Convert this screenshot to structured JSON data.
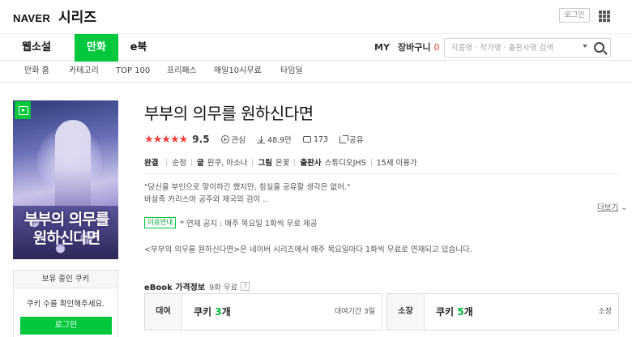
{
  "header": {
    "brand": "NAVER",
    "service": "시리즈",
    "login": "로그인"
  },
  "nav": {
    "tabs": [
      "웹소설",
      "만화",
      "e북"
    ],
    "active_tab": "만화",
    "my": "MY",
    "cart_label": "장바구니",
    "cart_count": "0",
    "search_placeholder": "작품명 · 작가명 · 출판사명 검색"
  },
  "subnav": {
    "items": [
      "만화 홈",
      "카테고리",
      "TOP 100",
      "프리패스",
      "매일10시무료",
      "타임딜"
    ]
  },
  "work": {
    "title": "부부의 의무를 원하신다면",
    "cover_title": "부부의 의무를 원하신다면",
    "stars": "★★★★★",
    "rating": "9.5",
    "interest_label": "관심",
    "downloads": "48.9만",
    "comments": "173",
    "share_label": "공유",
    "status": "완결",
    "genre": "순정",
    "writer_label": "글",
    "writer": "핀쿠, 아소나",
    "artist_label": "그림",
    "artist": "온꽃",
    "publisher_label": "출판사",
    "publisher": "스튜디오JHS",
    "age": "15세 이용가",
    "desc_line1": "\"당신을 부인으로 맞이하긴 했지만, 침실을 공유할 생각은 없어.\"",
    "desc_line2": "바살족 카리스마 공주와 제국의 검이 ..",
    "more_label": "더보기",
    "notice_tag": "이용안내",
    "notice_text": "* 연재 공지 : 매주 목요일 1화씩 무료 제공",
    "synopsis": "<부부의 의무를 원하신다면>은 네이버 시리즈에서 매주 목요일마다 1화씩 무료로 연재되고 있습니다."
  },
  "owned": {
    "heading": "보유 중인 쿠키",
    "message": "쿠키 수를 확인해주세요.",
    "login_button": "로그인"
  },
  "ebook": {
    "heading": "eBook 가격정보",
    "free_note": "9화 무료",
    "help": "?",
    "rent": {
      "label": "대여",
      "price_prefix": "쿠키 ",
      "price_num": "3",
      "price_suffix": "개",
      "period": "대여기간 3일"
    },
    "own": {
      "label": "소장",
      "price_prefix": "쿠키 ",
      "price_num": "5",
      "price_suffix": "개",
      "right": "소장"
    }
  },
  "colors": {
    "accent": "#00c73c",
    "star": "#ff3f3f",
    "cart_count": "#e03a3a"
  }
}
